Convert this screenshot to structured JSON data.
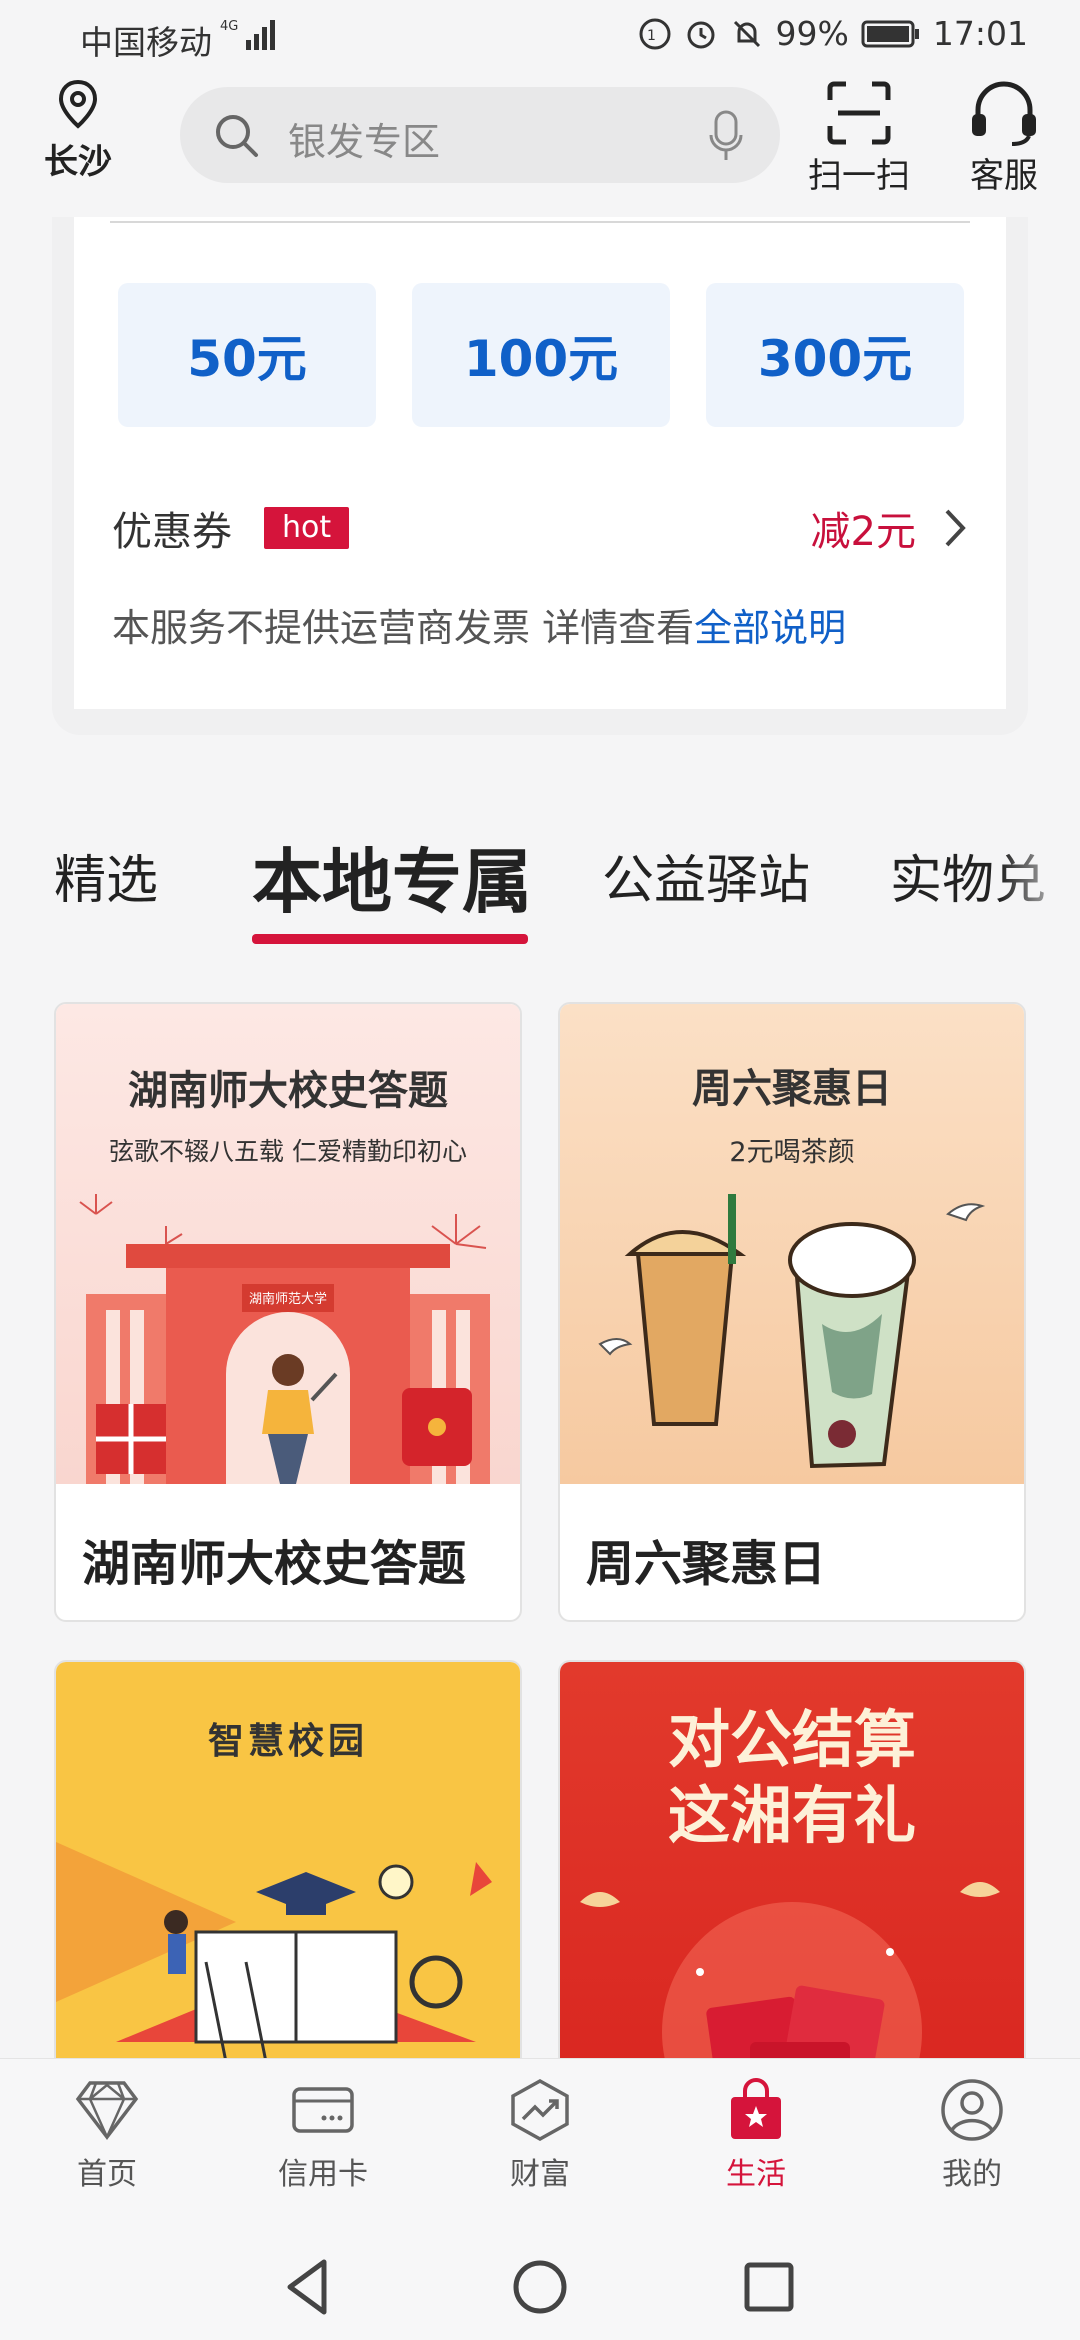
{
  "status_bar": {
    "carrier": "中国移动",
    "network": "4G",
    "battery": "99%",
    "time": "17:01"
  },
  "header": {
    "location": "长沙",
    "search_placeholder": "银发专区",
    "scan_label": "扫一扫",
    "service_label": "客服"
  },
  "recharge": {
    "amounts": [
      "50元",
      "100元",
      "300元"
    ],
    "coupon_label": "优惠券",
    "hot_badge": "hot",
    "coupon_value": "减2元",
    "notice_text": "本服务不提供运营商发票 详情查看",
    "notice_link": "全部说明"
  },
  "tabs": [
    {
      "label": "精选",
      "active": false
    },
    {
      "label": "本地专属",
      "active": true
    },
    {
      "label": "公益驿站",
      "active": false
    },
    {
      "label": "实物兑",
      "active": false
    }
  ],
  "products": [
    {
      "name": "湖南师大校史答题",
      "art_title": "湖南师大校史答题",
      "art_sub": "弦歌不辍八五载  仁爱精勤印初心",
      "gate_text": "湖南师范大学"
    },
    {
      "name": "周六聚惠日",
      "art_title": "周六聚惠日",
      "art_sub": "2元喝茶颜"
    },
    {
      "name": "",
      "art_title": "智慧校园"
    },
    {
      "name": "",
      "art_title_line1": "对公结算",
      "art_title_line2": "这湘有礼"
    }
  ],
  "bottom_nav": [
    {
      "label": "首页",
      "icon": "diamond-icon",
      "active": false
    },
    {
      "label": "信用卡",
      "icon": "credit-card-icon",
      "active": false
    },
    {
      "label": "财富",
      "icon": "wealth-chart-icon",
      "active": false
    },
    {
      "label": "生活",
      "icon": "shopping-bag-icon",
      "active": true
    },
    {
      "label": "我的",
      "icon": "user-icon",
      "active": false
    }
  ],
  "colors": {
    "accent": "#d5143b",
    "link": "#1060c8",
    "amount_bg": "#eef4fc"
  }
}
